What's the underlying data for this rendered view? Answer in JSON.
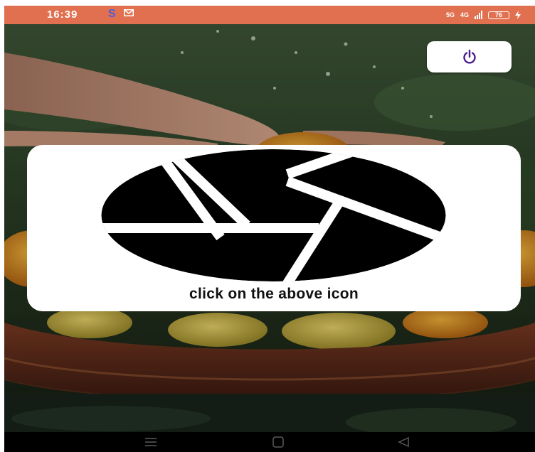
{
  "status_bar": {
    "time": "16:39",
    "app_badge": "S",
    "network_label_1": "5G",
    "network_label_2": "4G",
    "battery_level": "76",
    "background_color": "#e0704f"
  },
  "card": {
    "caption": "click on the above icon",
    "icon": "camera-shutter-icon"
  },
  "power_button": {
    "icon": "power-icon",
    "icon_color": "#4a1d8c"
  },
  "nav_bar": {
    "keys": [
      "menu-icon",
      "home-icon",
      "back-icon"
    ]
  }
}
